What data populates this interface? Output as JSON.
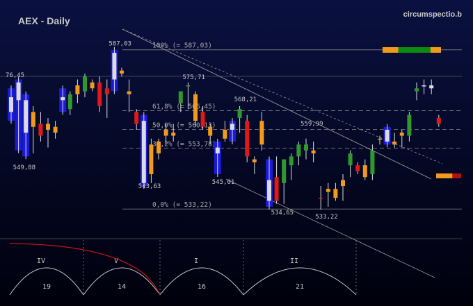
{
  "colors": {
    "background": "#000000",
    "panel_top": "#0a1140",
    "panel_bottom": "#00000c",
    "up": "#2e9a2e",
    "down": "#e01818",
    "orange": "#f39a1a",
    "blue_band": "#1a1adc",
    "text": "#c9c9c9",
    "fib_line": "#8a8a8a",
    "cycle_curve": "#c8c8c8",
    "wave_curve": "#c01818"
  },
  "header": {
    "title": "AEX - Daily",
    "brand": "circumspectio.b"
  },
  "chart_data": {
    "type": "candlestick",
    "title": "AEX - Daily",
    "ylim": [
      526,
      594
    ],
    "grid": false,
    "fibonacci": [
      {
        "label": "100% (= 587,03)",
        "value": 587.03
      },
      {
        "label": "61,8% (= 566,45)",
        "value": 566.45
      },
      {
        "label": "50,0% (= 560,13)",
        "value": 560.13
      },
      {
        "label": "38,2% (= 553,78)",
        "value": 553.78
      },
      {
        "label": "0,0% (= 533,22)",
        "value": 533.22
      }
    ],
    "price_labels": [
      {
        "text": "587,03",
        "index": 14,
        "value": 587.03,
        "pos": "above"
      },
      {
        "text": "76,45",
        "index": 0,
        "value": 576.45,
        "pos": "above"
      },
      {
        "text": "549,88",
        "index": 1,
        "value": 549.88,
        "pos": "below"
      },
      {
        "text": "575,71",
        "index": 24,
        "value": 575.71,
        "pos": "above"
      },
      {
        "text": "543,63",
        "index": 18,
        "value": 543.63,
        "pos": "below"
      },
      {
        "text": "568,21",
        "index": 31,
        "value": 568.21,
        "pos": "above"
      },
      {
        "text": "545,01",
        "index": 28,
        "value": 545.01,
        "pos": "below"
      },
      {
        "text": "559,99",
        "index": 40,
        "value": 559.99,
        "pos": "above"
      },
      {
        "text": "534,65",
        "index": 36,
        "value": 534.65,
        "pos": "below"
      },
      {
        "text": "533,22",
        "index": 42,
        "value": 533.22,
        "pos": "below"
      }
    ],
    "candles": [
      {
        "o": 566.0,
        "h": 574.0,
        "l": 563.0,
        "c": 571.0,
        "col": "blue"
      },
      {
        "o": 576.0,
        "h": 577.0,
        "l": 553.0,
        "c": 570.0,
        "col": "blue"
      },
      {
        "o": 570.0,
        "h": 572.0,
        "l": 551.0,
        "c": 559.0,
        "col": "blue"
      },
      {
        "o": 566.0,
        "h": 568.0,
        "l": 552.0,
        "c": 561.0,
        "col": "orange"
      },
      {
        "o": 562.0,
        "h": 566.0,
        "l": 556.0,
        "c": 558.0,
        "col": "red"
      },
      {
        "o": 560.0,
        "h": 564.0,
        "l": 554.0,
        "c": 562.0,
        "col": "orange"
      },
      {
        "o": 559.0,
        "h": 563.0,
        "l": 557.0,
        "c": 561.0,
        "col": "orange"
      },
      {
        "o": 570.0,
        "h": 574.0,
        "l": 566.0,
        "c": 571.0,
        "col": "blue"
      },
      {
        "o": 567.0,
        "h": 573.0,
        "l": 565.0,
        "c": 572.0,
        "col": "green"
      },
      {
        "o": 572.0,
        "h": 577.0,
        "l": 569.0,
        "c": 575.0,
        "col": "orange"
      },
      {
        "o": 573.0,
        "h": 579.0,
        "l": 571.0,
        "c": 578.0,
        "col": "green"
      },
      {
        "o": 576.0,
        "h": 577.0,
        "l": 573.0,
        "c": 574.0,
        "col": "orange"
      },
      {
        "o": 576.0,
        "h": 578.0,
        "l": 566.0,
        "c": 568.0,
        "col": "red"
      },
      {
        "o": 572.0,
        "h": 577.0,
        "l": 564.0,
        "c": 574.0,
        "col": "red"
      },
      {
        "o": 577.0,
        "h": 587.0,
        "l": 573.0,
        "c": 586.0,
        "col": "blue"
      },
      {
        "o": 580.0,
        "h": 581.0,
        "l": 578.0,
        "c": 579.0,
        "col": "orange"
      },
      {
        "o": 573.0,
        "h": 577.0,
        "l": 566.0,
        "c": 572.0,
        "col": "orange"
      },
      {
        "o": 566.0,
        "h": 567.0,
        "l": 560.0,
        "c": 562.0,
        "col": "red"
      },
      {
        "o": 563.0,
        "h": 565.0,
        "l": 541.0,
        "c": 542.0,
        "col": "blue"
      },
      {
        "o": 555.0,
        "h": 557.0,
        "l": 542.0,
        "c": 545.0,
        "col": "orange"
      },
      {
        "o": 556.0,
        "h": 557.0,
        "l": 550.0,
        "c": 552.0,
        "col": "orange"
      },
      {
        "o": 560.0,
        "h": 562.0,
        "l": 555.0,
        "c": 558.0,
        "col": "orange"
      },
      {
        "o": 558.0,
        "h": 562.0,
        "l": 556.0,
        "c": 559.0,
        "col": "orange"
      },
      {
        "o": 569.0,
        "h": 573.0,
        "l": 566.0,
        "c": 573.0,
        "col": "green"
      },
      {
        "o": 575.0,
        "h": 576.0,
        "l": 567.0,
        "c": 575.0,
        "col": "green"
      },
      {
        "o": 572.0,
        "h": 573.0,
        "l": 561.0,
        "c": 563.0,
        "col": "orange"
      },
      {
        "o": 566.0,
        "h": 568.0,
        "l": 560.0,
        "c": 561.0,
        "col": "red"
      },
      {
        "o": 561.0,
        "h": 562.0,
        "l": 555.0,
        "c": 558.0,
        "col": "orange"
      },
      {
        "o": 554.0,
        "h": 556.0,
        "l": 545.0,
        "c": 552.0,
        "col": "blue"
      },
      {
        "o": 560.0,
        "h": 563.0,
        "l": 556.0,
        "c": 557.0,
        "col": "orange"
      },
      {
        "o": 560.0,
        "h": 563.0,
        "l": 556.0,
        "c": 562.0,
        "col": "blue"
      },
      {
        "o": 564.0,
        "h": 568.0,
        "l": 559.0,
        "c": 567.0,
        "col": "green"
      },
      {
        "o": 563.0,
        "h": 565.0,
        "l": 549.0,
        "c": 551.0,
        "col": "red"
      },
      {
        "o": 550.0,
        "h": 551.0,
        "l": 545.0,
        "c": 549.0,
        "col": "orange"
      },
      {
        "o": 563.0,
        "h": 566.0,
        "l": 553.0,
        "c": 555.0,
        "col": "orange"
      },
      {
        "o": 543.0,
        "h": 550.0,
        "l": 534.0,
        "c": 536.0,
        "col": "blue"
      },
      {
        "o": 544.0,
        "h": 551.0,
        "l": 535.0,
        "c": 536.0,
        "col": "red"
      },
      {
        "o": 542.0,
        "h": 550.0,
        "l": 535.0,
        "c": 550.0,
        "col": "green"
      },
      {
        "o": 548.0,
        "h": 552.0,
        "l": 543.0,
        "c": 551.0,
        "col": "green"
      },
      {
        "o": 551.0,
        "h": 556.0,
        "l": 548.0,
        "c": 555.0,
        "col": "green"
      },
      {
        "o": 553.0,
        "h": 557.0,
        "l": 550.0,
        "c": 555.0,
        "col": "green"
      },
      {
        "o": 553.0,
        "h": 556.0,
        "l": 549.0,
        "c": 552.0,
        "col": "orange"
      },
      {
        "o": 537.0,
        "h": 541.0,
        "l": 533.0,
        "c": 537.0,
        "col": "red"
      },
      {
        "o": 540.0,
        "h": 542.0,
        "l": 534.0,
        "c": 539.0,
        "col": "orange"
      },
      {
        "o": 540.0,
        "h": 542.0,
        "l": 536.0,
        "c": 537.0,
        "col": "orange"
      },
      {
        "o": 543.0,
        "h": 545.0,
        "l": 536.0,
        "c": 541.0,
        "col": "orange"
      },
      {
        "o": 548.0,
        "h": 553.0,
        "l": 544.0,
        "c": 552.0,
        "col": "green"
      },
      {
        "o": 548.0,
        "h": 549.0,
        "l": 545.0,
        "c": 546.0,
        "col": "red"
      },
      {
        "o": 548.0,
        "h": 550.0,
        "l": 543.0,
        "c": 544.0,
        "col": "orange"
      },
      {
        "o": 545.0,
        "h": 555.0,
        "l": 543.0,
        "c": 553.0,
        "col": "green"
      },
      {
        "o": 557.0,
        "h": 558.0,
        "l": 555.0,
        "c": 557.0,
        "col": "orange"
      },
      {
        "o": 560.0,
        "h": 561.0,
        "l": 555.0,
        "c": 556.0,
        "col": "blue"
      },
      {
        "o": 556.0,
        "h": 559.0,
        "l": 554.0,
        "c": 555.0,
        "col": "orange"
      },
      {
        "o": 558.0,
        "h": 560.0,
        "l": 554.0,
        "c": 559.0,
        "col": "orange"
      },
      {
        "o": 558.0,
        "h": 566.0,
        "l": 556.0,
        "c": 565.0,
        "col": "green"
      },
      {
        "o": 573.0,
        "h": 576.0,
        "l": 570.0,
        "c": 574.0,
        "col": "green"
      },
      {
        "o": 575.0,
        "h": 577.0,
        "l": 572.0,
        "c": 575.0,
        "col": "white"
      },
      {
        "o": 575.0,
        "h": 577.0,
        "l": 572.0,
        "c": 574.0,
        "col": "white"
      },
      {
        "o": 564.0,
        "h": 565.0,
        "l": 561.0,
        "c": 562.0,
        "col": "red"
      }
    ],
    "top_bar": {
      "segments": [
        "orange",
        "green",
        "orange"
      ],
      "widths": [
        0.27,
        0.55,
        0.18
      ]
    },
    "side_bar": {
      "segments": [
        "orange",
        "red"
      ],
      "widths": [
        0.65,
        0.35
      ]
    }
  },
  "cycles": {
    "roman_labels": [
      "IV",
      "V",
      "I",
      "II"
    ],
    "lengths": [
      "19",
      "14",
      "16",
      "21"
    ]
  }
}
